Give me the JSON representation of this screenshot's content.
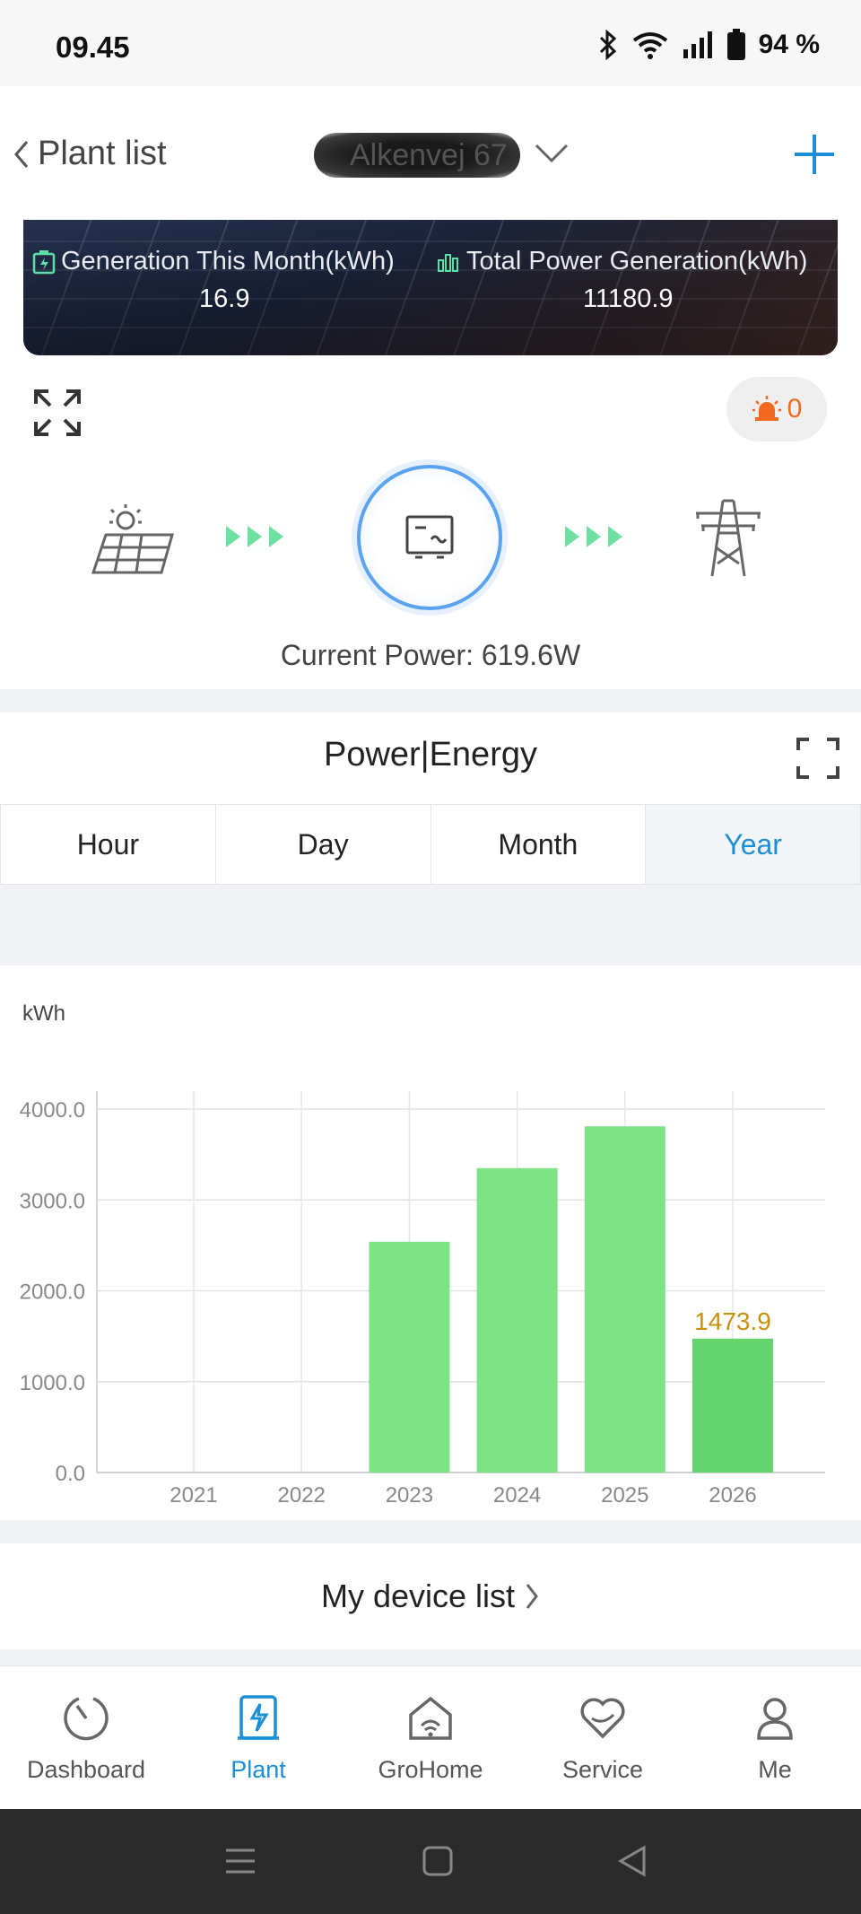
{
  "status_bar": {
    "time": "09.45",
    "battery": "94 %"
  },
  "header": {
    "back_label": "Plant list",
    "plant_name": "Alkenvej 67"
  },
  "banner": {
    "month_label": "Generation This Month(kWh)",
    "month_value": "16.9",
    "total_label": "Total Power Generation(kWh)",
    "total_value": "11180.9"
  },
  "alarm": {
    "count": "0"
  },
  "flow": {
    "current_power_label": "Current Power:",
    "current_power_value": "619.6W"
  },
  "power_section": {
    "title": "Power|Energy",
    "tabs": [
      {
        "label": "Hour",
        "active": false
      },
      {
        "label": "Day",
        "active": false
      },
      {
        "label": "Month",
        "active": false
      },
      {
        "label": "Year",
        "active": true
      }
    ]
  },
  "chart_data": {
    "type": "bar",
    "ylabel": "kWh",
    "categories": [
      "2021",
      "2022",
      "2023",
      "2024",
      "2025",
      "2026"
    ],
    "values": [
      0,
      0,
      2540,
      3350,
      3810,
      1473.9
    ],
    "ylim": [
      0,
      4000
    ],
    "yticks": [
      "0.0",
      "1000.0",
      "2000.0",
      "3000.0",
      "4000.0"
    ],
    "highlight": {
      "category": "2026",
      "label": "1473.9"
    },
    "colors": {
      "bar": "#7de384",
      "bar_highlight": "#66d46e",
      "label": "#c8900f"
    },
    "grid": true
  },
  "device_list": {
    "label": "My device list"
  },
  "tab_bar": [
    {
      "label": "Dashboard",
      "icon": "dashboard-icon",
      "active": false
    },
    {
      "label": "Plant",
      "icon": "plant-icon",
      "active": true
    },
    {
      "label": "GroHome",
      "icon": "grohome-icon",
      "active": false
    },
    {
      "label": "Service",
      "icon": "service-icon",
      "active": false
    },
    {
      "label": "Me",
      "icon": "me-icon",
      "active": false
    }
  ],
  "colors": {
    "accent": "#1a8fd6",
    "alarm": "#f26a21",
    "flow_arrow": "#6ee0a0"
  }
}
